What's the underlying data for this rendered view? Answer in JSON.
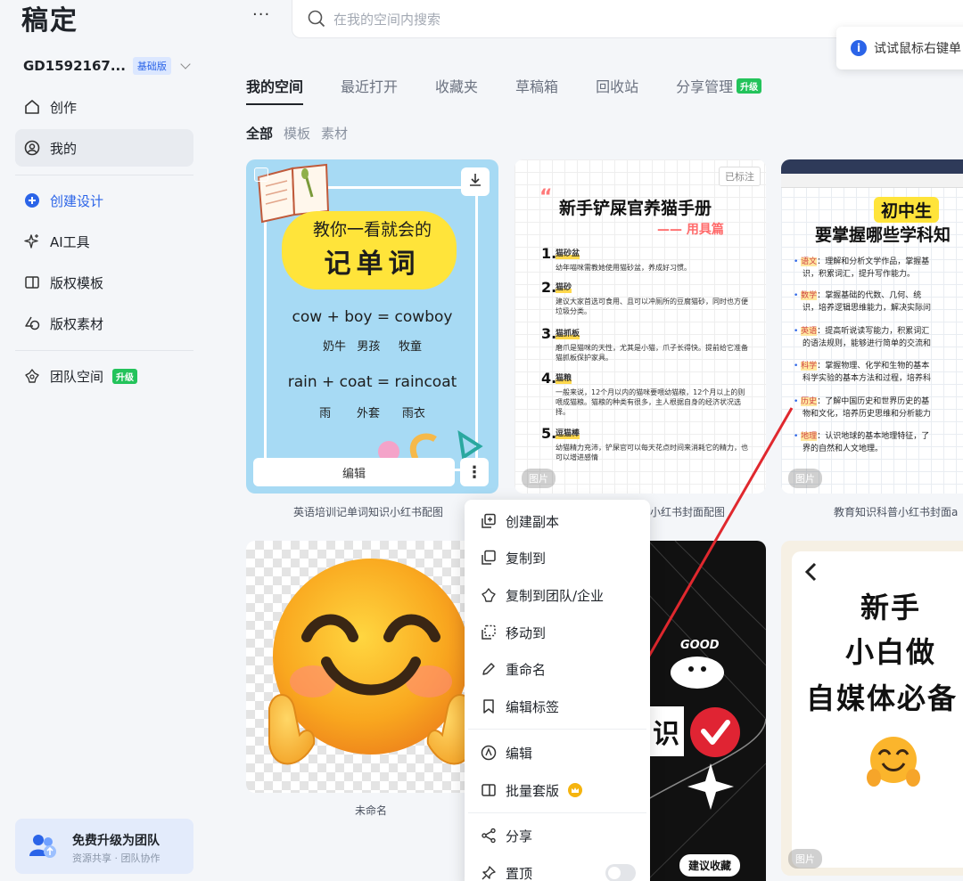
{
  "app": {
    "logo": "稿定"
  },
  "account": {
    "name": "GD1592167...",
    "plan": "基础版"
  },
  "sidebar": {
    "items": [
      {
        "label": "创作"
      },
      {
        "label": "我的"
      },
      {
        "label": "创建设计"
      },
      {
        "label": "AI工具"
      },
      {
        "label": "版权模板"
      },
      {
        "label": "版权素材"
      },
      {
        "label": "团队空间",
        "badge": "升级"
      }
    ],
    "upgrade": {
      "title": "免费升级为团队",
      "subtitle": "资源共享 · 团队协作"
    }
  },
  "search": {
    "placeholder": "在我的空间内搜索"
  },
  "tip": {
    "text": "试试鼠标右键单"
  },
  "tabs": [
    {
      "label": "我的空间"
    },
    {
      "label": "最近打开"
    },
    {
      "label": "收藏夹"
    },
    {
      "label": "草稿箱"
    },
    {
      "label": "回收站"
    },
    {
      "label": "分享管理",
      "badge": "升级"
    }
  ],
  "filters": [
    "全部",
    "模板",
    "素材"
  ],
  "cards": {
    "c1": {
      "caption": "英语培训记单词知识小红书配图",
      "line1": "教你一看就会的",
      "line2": "记单词",
      "eq1": "cow + boy = cowboy",
      "eq1_cn": "奶牛   男孩     牧童",
      "eq2": "rain + coat = raincoat",
      "eq2_cn": "雨       外套      雨衣",
      "edit": "编辑"
    },
    "c2": {
      "caption": "小红书封面配图",
      "marked": "已标注",
      "title": "新手铲屎官养猫手册",
      "subtitle": "—— 用具篇",
      "items": [
        {
          "n": "1.",
          "h": "猫砂盆",
          "t": "幼年喵咪需教她使用猫砂盆，养成好习惯。"
        },
        {
          "n": "2.",
          "h": "猫砂",
          "t": "建议大家首选可食用、且可以冲厕所的豆腐猫砂，同时也方便垃圾分类。"
        },
        {
          "n": "3.",
          "h": "猫抓板",
          "t": "磨爪是猫咪的天性，尤其是小猫，爪子长得快。提前给它准备猫抓板保护家具。"
        },
        {
          "n": "4.",
          "h": "猫粮",
          "t": "一般来说，12个月以内的猫咪要喂幼猫粮，12个月以上的则喂成猫粮。猫粮的种类有很多，主人根据自身的经济状况选择。"
        },
        {
          "n": "5.",
          "h": "逗猫棒",
          "t": "幼猫精力充沛，铲屎官可以每天花点时间来消耗它的精力，也可以增进感情"
        }
      ],
      "tag": "图片"
    },
    "c3": {
      "caption": "教育知识科普小红书封面a",
      "pill": "初中生",
      "big": "要掌握哪些学科知",
      "lines": [
        {
          "k": "语文",
          "t": "：理解和分析文学作品，掌握基"
        },
        {
          "k": "",
          "t": "识，积累词汇，提升写作能力。"
        },
        {
          "k": "数学",
          "t": "：掌握基础的代数、几何、统"
        },
        {
          "k": "",
          "t": "识，培养逻辑思维能力，解决实际问"
        },
        {
          "k": "英语",
          "t": "：提高听说读写能力，积累词汇"
        },
        {
          "k": "",
          "t": "的语法规则，能够进行简单的交流和"
        },
        {
          "k": "科学",
          "t": "：掌握物理、化学和生物的基本"
        },
        {
          "k": "",
          "t": "科学实验的基本方法和过程，培养科"
        },
        {
          "k": "历史",
          "t": "：了解中国历史和世界历史的基"
        },
        {
          "k": "",
          "t": "物和文化，培养历史思维和分析能力"
        },
        {
          "k": "地理",
          "t": "：认识地球的基本地理特征，了"
        },
        {
          "k": "",
          "t": "界的自然和人文地理。"
        }
      ],
      "tag": "图片"
    },
    "c4": {
      "caption": "未命名"
    },
    "c5": {
      "big": "识",
      "good": "GOOD",
      "suggest": "建议收藏"
    },
    "c6": {
      "h1": "新手",
      "h2": "小白做",
      "h3": "自媒体必备",
      "tag": "图片"
    }
  },
  "context_menu": {
    "items": [
      {
        "label": "创建副本",
        "icon": "copy-plus-icon"
      },
      {
        "label": "复制到",
        "icon": "copy-icon"
      },
      {
        "label": "复制到团队/企业",
        "icon": "team-icon"
      },
      {
        "label": "移动到",
        "icon": "move-icon"
      },
      {
        "label": "重命名",
        "icon": "pencil-icon"
      },
      {
        "label": "编辑标签",
        "icon": "bookmark-icon"
      },
      {
        "label": "编辑",
        "icon": "edit-circle-icon"
      },
      {
        "label": "批量套版",
        "icon": "batch-icon",
        "premium": true
      },
      {
        "label": "分享",
        "icon": "share-icon"
      },
      {
        "label": "置顶",
        "icon": "pin-icon"
      }
    ]
  },
  "colors": {
    "accent": "#2b64e8",
    "upgrade_badge": "#23c35b",
    "arrow": "#e0282e"
  }
}
